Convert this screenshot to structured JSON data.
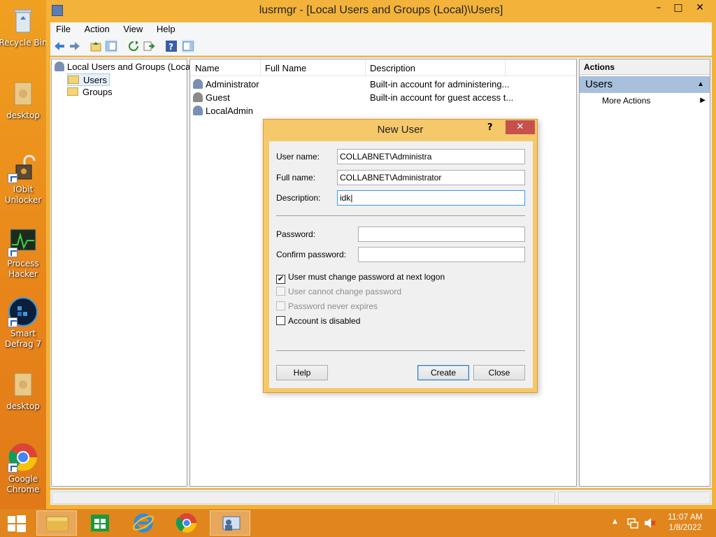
{
  "desktop": {
    "icons": [
      {
        "label": "Recycle Bin"
      },
      {
        "label": "desktop"
      },
      {
        "label": "IObit Unlocker"
      },
      {
        "label": "Process Hacker"
      },
      {
        "label": "Smart Defrag 7"
      },
      {
        "label": "desktop"
      },
      {
        "label": "Google Chrome"
      }
    ]
  },
  "window": {
    "title": "lusrmgr - [Local Users and Groups (Local)\\Users]",
    "controls": {
      "minimize": "–",
      "maximize": "□",
      "close": "✕"
    },
    "menu": [
      "File",
      "Action",
      "View",
      "Help"
    ]
  },
  "tree": {
    "root": "Local Users and Groups (Local)",
    "items": [
      "Users",
      "Groups"
    ]
  },
  "list": {
    "columns": [
      "Name",
      "Full Name",
      "Description"
    ],
    "rows": [
      {
        "name": "Administrator",
        "full_name": "",
        "description": "Built-in account for administering..."
      },
      {
        "name": "Guest",
        "full_name": "",
        "description": "Built-in account for guest access t..."
      },
      {
        "name": "LocalAdmin",
        "full_name": "",
        "description": ""
      }
    ]
  },
  "actions": {
    "header": "Actions",
    "section": "Users",
    "items": [
      "More Actions"
    ]
  },
  "dialog": {
    "title": "New User",
    "help_glyph": "?",
    "close_glyph": "✕",
    "username_label": "User name:",
    "username_value": "COLLABNET\\Administra",
    "fullname_label": "Full name:",
    "fullname_value": "COLLABNET\\Administrator",
    "description_label": "Description:",
    "description_value": "idk|",
    "password_label": "Password:",
    "password_value": "",
    "confirm_label": "Confirm password:",
    "confirm_value": "",
    "checkboxes": [
      {
        "label": "User must change password at next logon",
        "checked": true,
        "enabled": true
      },
      {
        "label": "User cannot change password",
        "checked": false,
        "enabled": false
      },
      {
        "label": "Password never expires",
        "checked": false,
        "enabled": false
      },
      {
        "label": "Account is disabled",
        "checked": false,
        "enabled": true
      }
    ],
    "buttons": {
      "help": "Help",
      "create": "Create",
      "close": "Close"
    }
  },
  "taskbar": {
    "time": "11:07 AM",
    "date": "1/8/2022"
  },
  "colors": {
    "desktop": "#e8881e",
    "window_frame": "#f3b33a",
    "dialog_frame": "#f5c86a",
    "close_red": "#c7504d",
    "actions_section": "#a9c0dd"
  }
}
